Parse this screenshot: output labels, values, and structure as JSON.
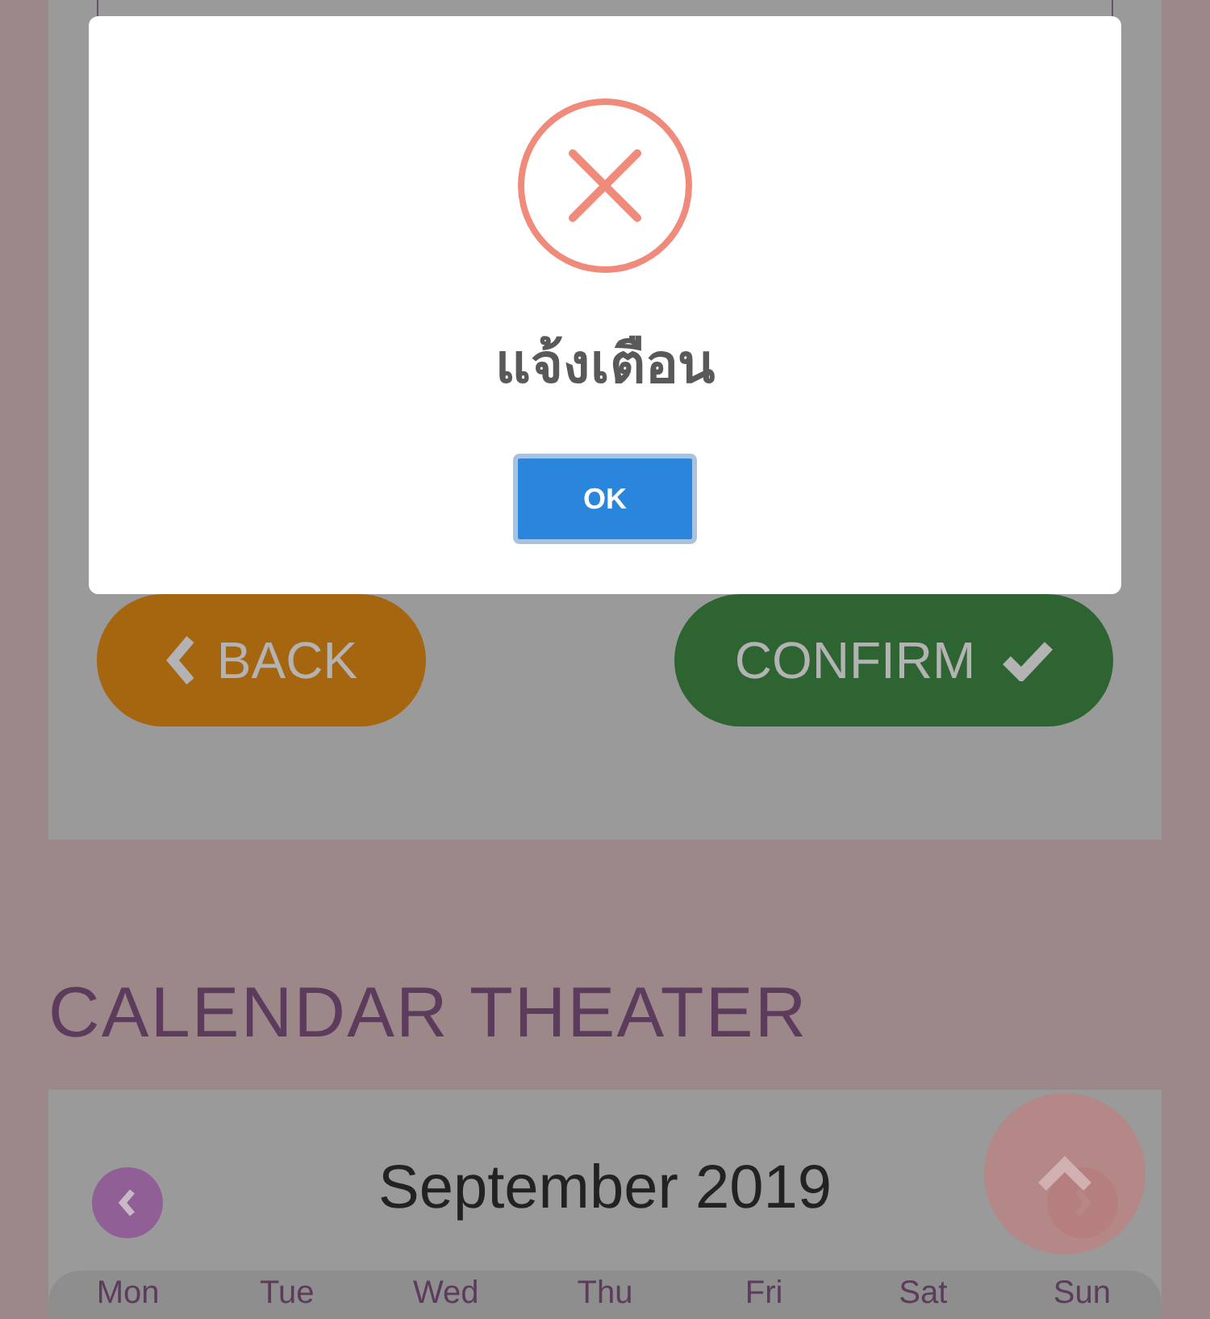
{
  "form": {
    "back_button": "BACK",
    "confirm_button": "CONFIRM"
  },
  "calendar": {
    "title": "CALENDAR THEATER",
    "month": "September 2019",
    "weekdays": [
      "Mon",
      "Tue",
      "Wed",
      "Thu",
      "Fri",
      "Sat",
      "Sun"
    ]
  },
  "alert": {
    "kind": "error",
    "title": "แจ้งเตือน",
    "button": "OK"
  }
}
